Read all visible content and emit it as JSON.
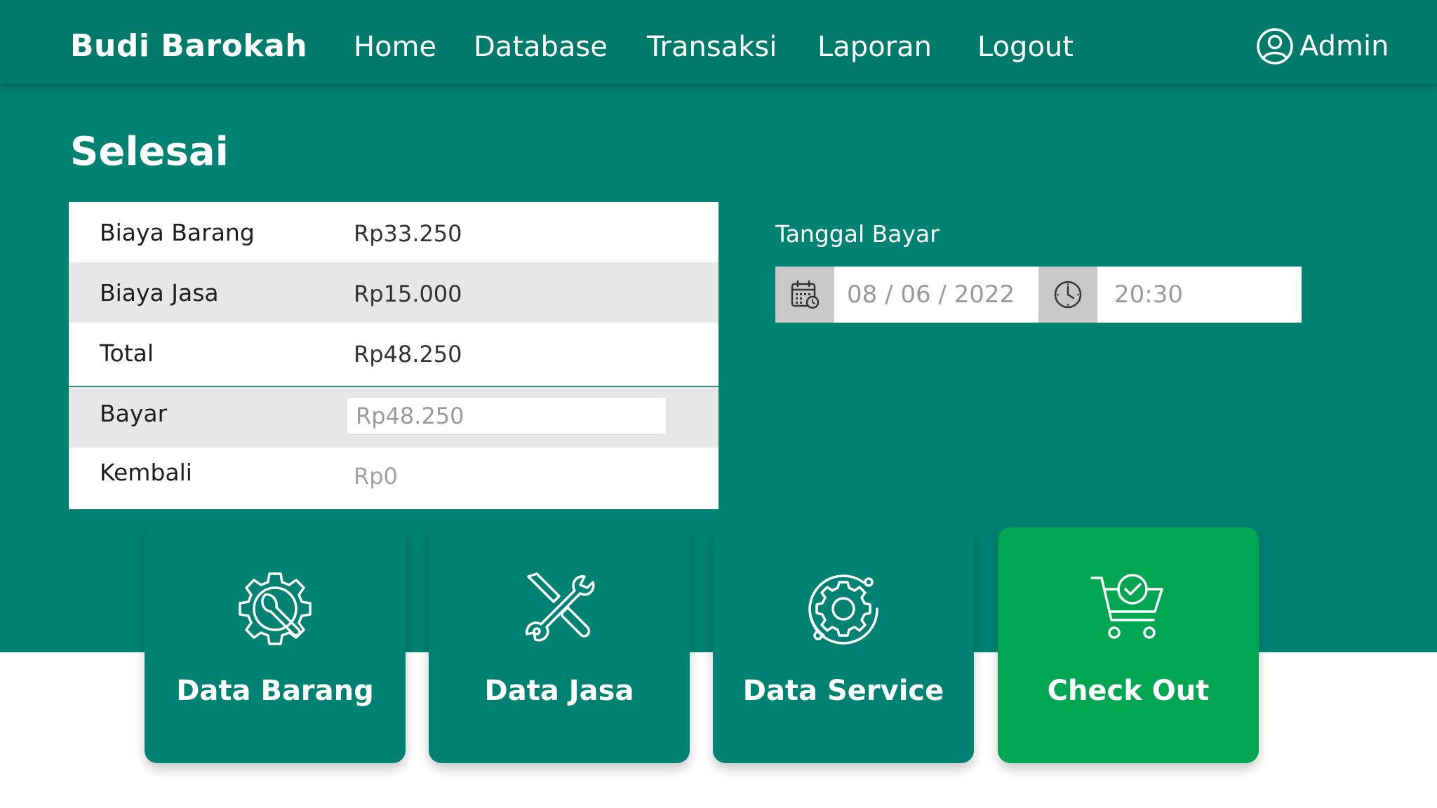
{
  "brand": "Budi Barokah",
  "nav": {
    "home": "Home",
    "database": "Database",
    "transaksi": "Transaksi",
    "laporan": "Laporan",
    "logout": "Logout"
  },
  "user": {
    "name": "Admin",
    "icon": "user-circle-icon"
  },
  "page_title": "Selesai",
  "summary": {
    "biaya_barang": {
      "label": "Biaya Barang",
      "value": "Rp33.250"
    },
    "biaya_jasa": {
      "label": "Biaya Jasa",
      "value": "Rp15.000"
    },
    "total": {
      "label": "Total",
      "value": "Rp48.250"
    },
    "bayar": {
      "label": "Bayar",
      "value": "Rp48.250"
    },
    "kembali": {
      "label": "Kembali",
      "value": "Rp0"
    }
  },
  "payment_date": {
    "label": "Tanggal Bayar",
    "date": "08 / 06 / 2022",
    "time": "20:30",
    "date_icon": "calendar-icon",
    "time_icon": "clock-icon"
  },
  "cards": {
    "data_barang": {
      "label": "Data Barang",
      "icon": "gear-wrench-icon"
    },
    "data_jasa": {
      "label": "Data Jasa",
      "icon": "tools-icon"
    },
    "data_service": {
      "label": "Data Service",
      "icon": "gear-cycle-icon"
    },
    "check_out": {
      "label": "Check Out",
      "icon": "cart-check-icon"
    }
  },
  "colors": {
    "primary": "#008272",
    "navbar": "#007A6A",
    "checkout": "#00A651",
    "row_alt": "#E6E7E9"
  }
}
